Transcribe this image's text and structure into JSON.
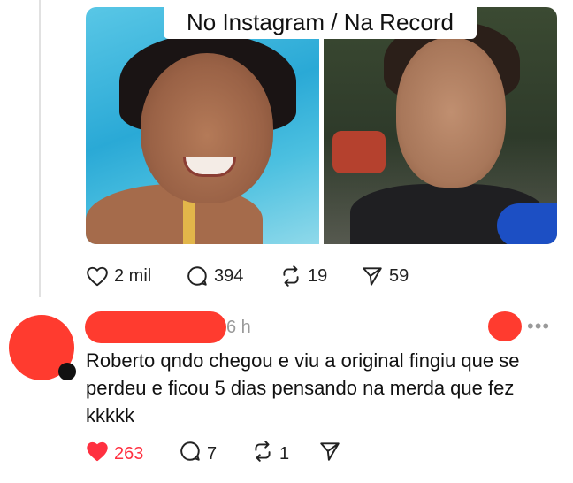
{
  "post": {
    "image_caption": "No Instagram / Na Record",
    "stats": {
      "likes": "2 mil",
      "comments": "394",
      "reposts": "19",
      "shares": "59"
    }
  },
  "reply": {
    "time": "6 h",
    "more_icon": "more-dots-icon",
    "lines": [
      "Roberto qndo chegou e viu a original fingiu que se",
      "perdeu e ficou 5 dias pensando na merda que fez",
      "kkkkk"
    ],
    "actions": {
      "likes": "263",
      "comments": "7",
      "reposts": "1"
    },
    "like_color": "#ff3040"
  },
  "redaction_color": "#ff3b2f"
}
